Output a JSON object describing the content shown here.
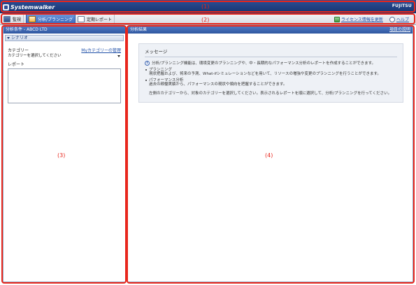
{
  "titlebar": {
    "brand": "Systemwalker",
    "vendor": "FUJITSU"
  },
  "tabs": [
    {
      "label": "監視",
      "icon": "monitor-icon"
    },
    {
      "label": "分析/プランニング",
      "icon": "analysis-icon"
    },
    {
      "label": "定期レポート",
      "icon": "report-icon"
    }
  ],
  "header_links": {
    "license": "ライセンス情報を更新",
    "help": "ヘルプ"
  },
  "left_panel": {
    "title": "分析条件 - ABCD LTD",
    "scenario": "シナリオ",
    "category_label": "カテゴリー",
    "my_category_link": "Myカテゴリーの管理",
    "category_select": "カテゴリーを選択してください",
    "report_label": "レポート"
  },
  "right_panel": {
    "title": "分析結果",
    "help_link": "項目の説明",
    "message_title": "メッセージ",
    "intro": "分析/プランニング機能は、環境変更のプランニングや、中・長期的なパフォーマンス分析のレポートを作成することができます。",
    "bullets": [
      {
        "title": "プランニング",
        "desc": "現状把握および、将来の予測、What-ifシミュレーションなどを用いて、リソースの増強や変更のプランニングを行うことができます。"
      },
      {
        "title": "パフォーマンス分析",
        "desc": "過去の稼働実績から、パフォーマンスの現状や傾向を把握することができます。"
      }
    ],
    "instruction": "左側のカテゴリーから、対象のカテゴリーを選択してください。表示されるレポートを順に選択して、分析/プランニングを行ってください。"
  },
  "annotations": [
    "(1)",
    "(2)",
    "(3)",
    "(4)"
  ],
  "colors": {
    "annotation": "#e8261c",
    "header_blue": "#2f57a0",
    "link": "#1f4fa8"
  }
}
